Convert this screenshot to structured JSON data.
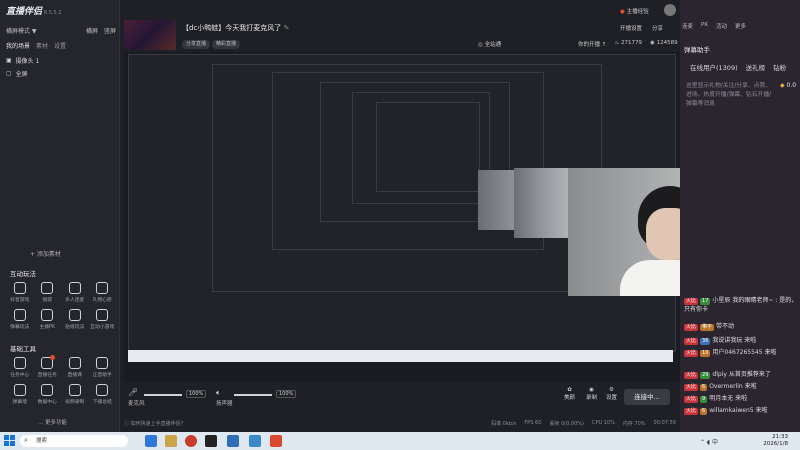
{
  "app": {
    "name": "直播伴侣",
    "version": "6.5.5.2"
  },
  "left": {
    "mode": "横屏模式 ▼",
    "mode_right": [
      "横屏",
      "竖屏"
    ],
    "tabs": [
      "我的场景",
      "素材",
      "设置"
    ],
    "scenes": [
      "摄像头 1",
      "全屏"
    ],
    "add_source": "+ 添加素材",
    "interact_title": "互动玩法",
    "interact_tools": [
      "抖音游戏",
      "福袋",
      "多人连麦",
      "礼物心愿",
      "弹幕玩法",
      "主播PK",
      "贴纸玩法",
      "互动小游戏"
    ],
    "basic_title": "基础工具",
    "basic_tools": [
      "任务中心",
      "直播任务",
      "直播课",
      "正音助手",
      "弹幕墙",
      "数据中心",
      "视频录制",
      "下播总结"
    ],
    "more": "... 更多功能"
  },
  "stream": {
    "title": "【dc小鸭蛙】今天我打麦克风了",
    "edit_icon": "edit-icon",
    "chips": [
      "分享直播",
      "精彩直播"
    ],
    "share": "全站通",
    "room_info": [
      "你的开播 ↑",
      "271779",
      "124589"
    ]
  },
  "top_right": {
    "hours": "主播经验",
    "settings": "开播设置",
    "share": "分享"
  },
  "audio": {
    "mic_label": "麦克风",
    "mic_pct": "100%",
    "mic_level": 1.0,
    "speaker_label": "扬声器",
    "speaker_pct": "100%",
    "speaker_level": 1.0,
    "effects": [
      "美颜",
      "录制",
      "设置"
    ],
    "connect": "连接中..."
  },
  "status": {
    "tip": "如何快速上手直播伴侣?",
    "stats": [
      "码率 0kb/s",
      "FPS 60",
      "丢帧 0(0.00%)",
      "CPU 10%",
      "内存 70%",
      "00:07:59"
    ]
  },
  "right": {
    "tabs": [
      "连麦",
      "PK",
      "活动",
      "更多"
    ],
    "header": "弹幕助手",
    "online": "在线用户(1309)",
    "lianmai": "送礼榜",
    "gifts": "钻粉",
    "gift_count": "0.0",
    "notice": "这里显示礼物/关注/分享、点赞、进场、热度开播/弹幕、钻石开播/弹幕等消息",
    "messages": [
      {
        "tags": [
          "火比",
          "17"
        ],
        "name": "小星辰",
        "text": "我的眼睛老师~ : 是的，只有你卡"
      },
      {
        "tags": [
          "火比",
          "带不"
        ],
        "name": "",
        "text": "带不动"
      },
      {
        "tags": [
          "火比",
          "36"
        ],
        "name": "",
        "text": "我说讲我玩 来啦"
      },
      {
        "tags": [
          "火比",
          "10"
        ],
        "name": "用户0467265545",
        "text": "来啦"
      },
      {
        "tags": [
          "火比",
          "29"
        ],
        "name": "dlpiy",
        "text": "从首页推荐来了"
      },
      {
        "tags": [
          "火比",
          "6"
        ],
        "name": "Overmerlin",
        "text": "来啦"
      },
      {
        "tags": [
          "火比",
          "9"
        ],
        "name": "明月本无",
        "text": "来啦"
      },
      {
        "tags": [
          "火比",
          "6"
        ],
        "name": "willamkaiwen5",
        "text": "来啦"
      }
    ]
  },
  "taskbar": {
    "search": "搜索",
    "time": "21:33",
    "date": "2026/1/8"
  },
  "colors": {
    "accent": "#e24b2d",
    "bg": "#1f2026",
    "panel": "#25262d",
    "danmu_bg": "#2b2530",
    "tag_red": "#c8333a"
  }
}
